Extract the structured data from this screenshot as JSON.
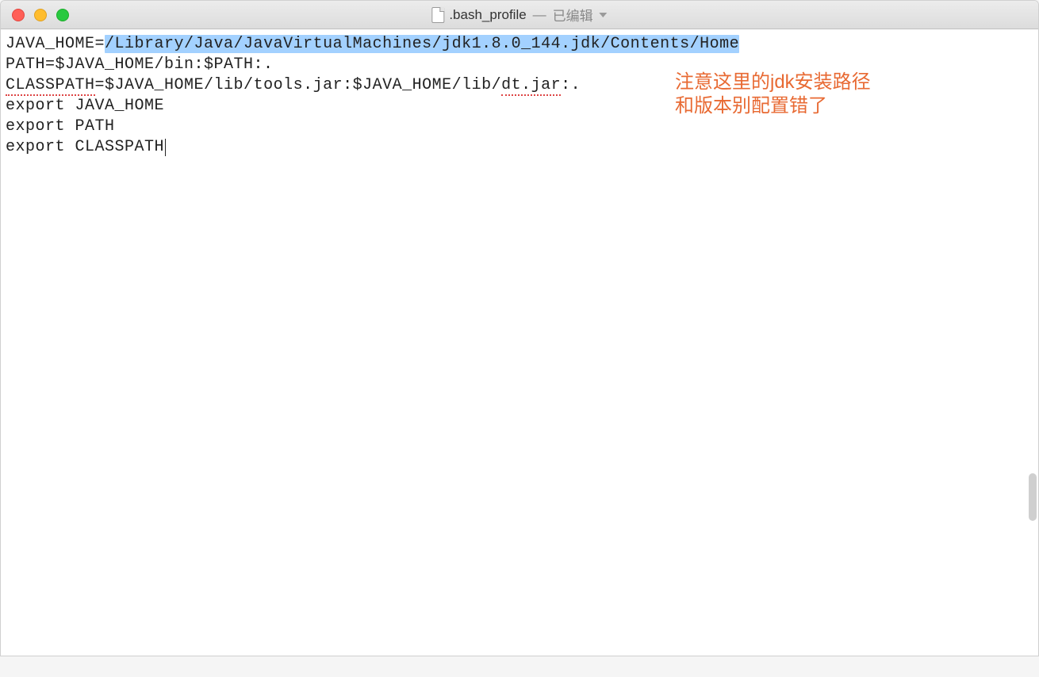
{
  "titlebar": {
    "filename": ".bash_profile",
    "separator": "—",
    "status": "已编辑"
  },
  "editor": {
    "lines": {
      "l1_pre": "JAVA_HOME=",
      "l1_hl": "/Library/Java/JavaVirtualMachines/jdk1.8.0_144.jdk/Contents/Home",
      "l2": "PATH=$JAVA_HOME/bin:$PATH:.",
      "l3_a": "CLASSPATH",
      "l3_b": "=$JAVA_HOME/lib/tools.jar:$JAVA_HOME/lib/",
      "l3_c": "dt.jar",
      "l3_d": ":.",
      "l4": "export JAVA_HOME",
      "l5": "export PATH",
      "l6": "export CLASSPATH"
    }
  },
  "annotation": {
    "line1": "注意这里的jdk安装路径",
    "line2": "和版本别配置错了"
  },
  "colors": {
    "highlight": "#3399ff",
    "annotation": "#e86a33"
  }
}
